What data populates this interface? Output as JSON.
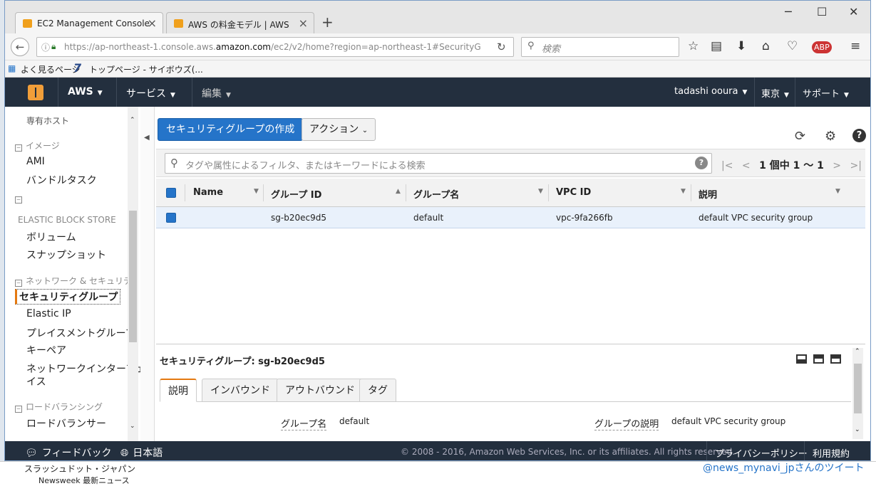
{
  "browser": {
    "tabs": [
      {
        "label": "EC2 Management Console"
      },
      {
        "label": "AWS の料金モデル | AWS"
      }
    ],
    "url_prefix": "https://ap-northeast-1.console.aws.",
    "url_domain": "amazon.com",
    "url_suffix": "/ec2/v2/home?region=ap-northeast-1#SecurityG",
    "search_placeholder": "検索",
    "bookmarks": [
      {
        "label": "よく見るページ"
      },
      {
        "label": "トップページ - サイボウズ(..."
      }
    ]
  },
  "aws_nav": {
    "brand": "AWS",
    "services": "サービス",
    "edit": "編集",
    "user": "tadashi ooura",
    "region": "東京",
    "support": "サポート"
  },
  "sidebar": {
    "cut_top": "専有ホスト",
    "images_header": "イメージ",
    "ami": "AMI",
    "bundle_tasks": "バンドルタスク",
    "ebs_header": "ELASTIC BLOCK STORE",
    "volumes": "ボリューム",
    "snapshots": "スナップショット",
    "network_header": "ネットワーク & セキュリティ",
    "security_groups": "セキュリティグループ",
    "elastic_ip": "Elastic IP",
    "placement_groups": "プレイスメントグループ",
    "key_pairs": "キーペア",
    "network_interfaces_1": "ネットワークインターフェ",
    "network_interfaces_2": "イス",
    "lb_header": "ロードバランシング",
    "load_balancers": "ロードバランサー"
  },
  "toolbar": {
    "create_label": "セキュリティグループの作成",
    "actions_label": "アクション"
  },
  "filter": {
    "placeholder": "タグや属性によるフィルタ、またはキーワードによる検索",
    "pager": "1 個中 1 ～ 1"
  },
  "table": {
    "columns": [
      "Name",
      "グループ ID",
      "グループ名",
      "VPC ID",
      "説明"
    ],
    "rows": [
      {
        "name": "",
        "group_id": "sg-b20ec9d5",
        "group_name": "default",
        "vpc_id": "vpc-9fa266fb",
        "description": "default VPC security group"
      }
    ]
  },
  "details": {
    "title": "セキュリティグループ: sg-b20ec9d5",
    "tabs": [
      "説明",
      "インバウンド",
      "アウトバウンド",
      "タグ"
    ],
    "group_name_label": "グループ名",
    "group_name_value": "default",
    "group_desc_label": "グループの説明",
    "group_desc_value": "default VPC security group"
  },
  "footer": {
    "feedback": "フィードバック",
    "language": "日本語",
    "copyright": "© 2008 - 2016, Amazon Web Services, Inc. or its affiliates. All rights reserved.",
    "privacy": "プライバシーポリシー",
    "terms": "利用規約"
  },
  "background": {
    "item1": "スラッシュドット・ジャパン",
    "item2": "Newsweek 最新ニュース",
    "tweet": "@news_mynavi_jpさんのツイート"
  },
  "colors": {
    "aws_nav_bg": "#232f3e",
    "primary_button": "#2574c9",
    "aws_orange": "#f19e39",
    "selected_row": "#e9f1fb"
  }
}
